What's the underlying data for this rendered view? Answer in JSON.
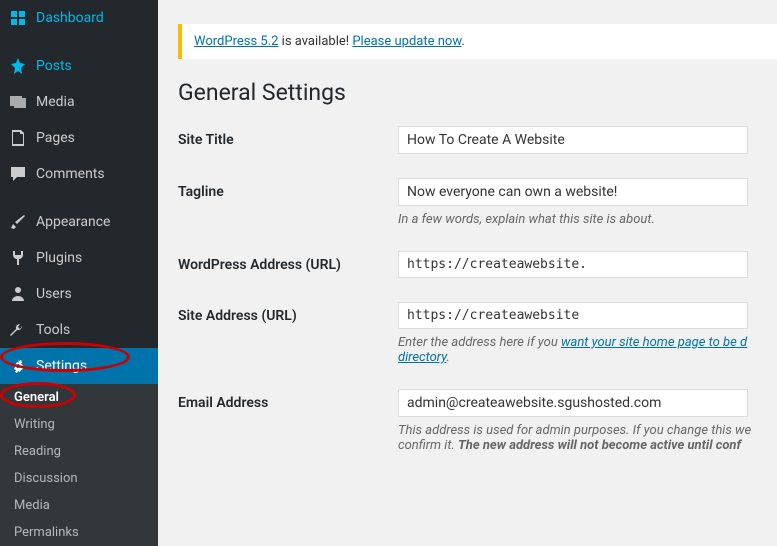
{
  "sidebar": {
    "items": [
      {
        "label": "Dashboard",
        "icon": "dashboard"
      },
      {
        "label": "Posts",
        "icon": "pin"
      },
      {
        "label": "Media",
        "icon": "media"
      },
      {
        "label": "Pages",
        "icon": "page"
      },
      {
        "label": "Comments",
        "icon": "comment"
      },
      {
        "label": "Appearance",
        "icon": "brush"
      },
      {
        "label": "Plugins",
        "icon": "plug"
      },
      {
        "label": "Users",
        "icon": "user"
      },
      {
        "label": "Tools",
        "icon": "wrench"
      },
      {
        "label": "Settings",
        "icon": "gear"
      }
    ],
    "submenu": [
      {
        "label": "General"
      },
      {
        "label": "Writing"
      },
      {
        "label": "Reading"
      },
      {
        "label": "Discussion"
      },
      {
        "label": "Media"
      },
      {
        "label": "Permalinks"
      }
    ]
  },
  "notice": {
    "link1": "WordPress 5.2",
    "mid": " is available! ",
    "link2": "Please update now"
  },
  "page_title": "General Settings",
  "fields": {
    "site_title": {
      "label": "Site Title",
      "value": "How To Create A Website"
    },
    "tagline": {
      "label": "Tagline",
      "value": "Now everyone can own a website!",
      "desc": "In a few words, explain what this site is about."
    },
    "wp_url": {
      "label": "WordPress Address (URL)",
      "value": "https://createawebsite."
    },
    "site_url": {
      "label": "Site Address (URL)",
      "value": "https://createawebsite",
      "desc_pre": "Enter the address here if you ",
      "desc_link": "want your site home page to be d",
      "desc_post": "directory"
    },
    "email": {
      "label": "Email Address",
      "value": "admin@createawebsite.sgushosted.com",
      "desc_pre": "This address is used for admin purposes. If you change this we ",
      "desc_mid": "confirm it. ",
      "desc_strong": "The new address will not become active until conf"
    }
  }
}
